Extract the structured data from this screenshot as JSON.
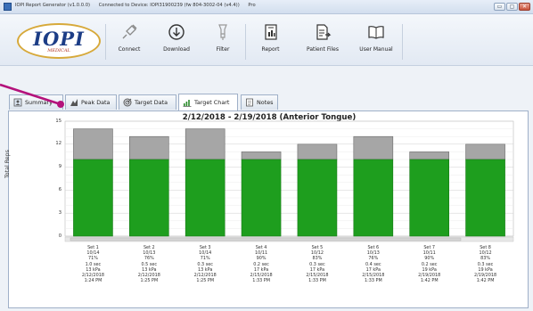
{
  "window": {
    "title_parts": [
      "IOPI Report Generator (v1.0.0.0)",
      "Connected to Device: IOPI31900239 (fw 804-3002-04 (v4.4))",
      "Pro"
    ]
  },
  "window_buttons": {
    "minimize": "▭",
    "maximize": "▢",
    "close": "✕"
  },
  "logo": {
    "text": "IOPI",
    "sub": "MEDICAL"
  },
  "toolbar": [
    {
      "label": "Connect",
      "icon": "plug-icon"
    },
    {
      "label": "Download",
      "icon": "download-icon"
    },
    {
      "label": "Filter",
      "icon": "filter-icon"
    },
    {
      "label": "Report",
      "icon": "report-icon"
    },
    {
      "label": "Patient Files",
      "icon": "patient-files-icon"
    },
    {
      "label": "User Manual",
      "icon": "user-manual-icon"
    }
  ],
  "tabs": [
    {
      "label": "Summary",
      "icon": "summary-icon"
    },
    {
      "label": "Peak Data",
      "icon": "peak-data-icon"
    },
    {
      "label": "Target Data",
      "icon": "target-data-icon"
    },
    {
      "label": "Target Chart",
      "icon": "target-chart-icon"
    },
    {
      "label": "Notes",
      "icon": "notes-icon"
    }
  ],
  "colors": {
    "green": "#1e9e1e",
    "gray": "#a6a6a6",
    "accent": "#b4127b"
  },
  "chart_data": {
    "type": "bar",
    "title": "2/12/2018 - 2/19/2018 (Anterior Tongue)",
    "ylabel": "Total Reps",
    "ylim": [
      0,
      15
    ],
    "yticks": [
      0,
      3,
      6,
      9,
      12,
      15
    ],
    "grid": true,
    "categories": [
      [
        "Set 1",
        "10/14",
        "71%",
        "1.0 sec",
        "13 kPa",
        "2/12/2018",
        "1:24 PM"
      ],
      [
        "Set 2",
        "10/13",
        "76%",
        "0.5 sec",
        "13 kPa",
        "2/12/2018",
        "1:25 PM"
      ],
      [
        "Set 3",
        "10/14",
        "71%",
        "0.3 sec",
        "13 kPa",
        "2/12/2018",
        "1:25 PM"
      ],
      [
        "Set 4",
        "10/11",
        "90%",
        "0.2 sec",
        "17 kPa",
        "2/15/2018",
        "1:33 PM"
      ],
      [
        "Set 5",
        "10/12",
        "83%",
        "0.3 sec",
        "17 kPa",
        "2/15/2018",
        "1:33 PM"
      ],
      [
        "Set 6",
        "10/13",
        "76%",
        "0.4 sec",
        "17 kPa",
        "2/15/2018",
        "1:33 PM"
      ],
      [
        "Set 7",
        "10/11",
        "90%",
        "0.2 sec",
        "19 kPa",
        "2/19/2018",
        "1:42 PM"
      ],
      [
        "Set 8",
        "10/12",
        "83%",
        "0.3 sec",
        "19 kPa",
        "2/19/2018",
        "1:42 PM"
      ]
    ],
    "series": [
      {
        "values": [
          10,
          10,
          10,
          10,
          10,
          10,
          10,
          10
        ],
        "color": "#1e9e1e"
      },
      {
        "values": [
          14,
          13,
          14,
          11,
          12,
          13,
          11,
          12
        ],
        "color": "#a6a6a6"
      }
    ]
  }
}
